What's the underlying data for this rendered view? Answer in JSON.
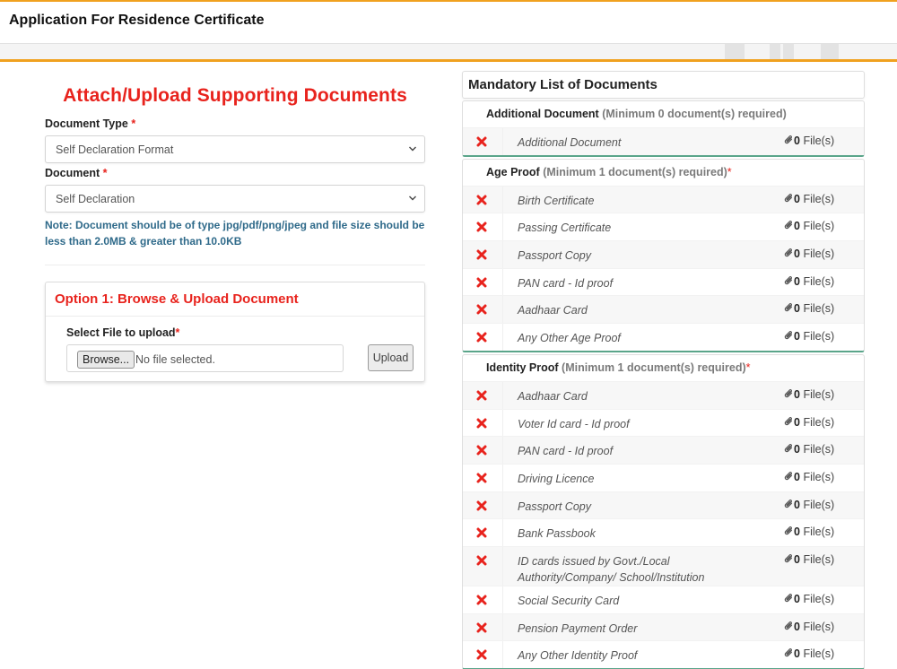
{
  "header": {
    "title": "Application For Residence Certificate"
  },
  "upload": {
    "heading": "Attach/Upload Supporting Documents",
    "document_type": {
      "label": "Document Type",
      "required_mark": "*",
      "value": "Self Declaration Format"
    },
    "document": {
      "label": "Document",
      "required_mark": "*",
      "value": "Self Declaration"
    },
    "note": "Note: Document should be of type jpg/pdf/png/jpeg and file size should be less than 2.0MB & greater than 10.0KB",
    "option1": {
      "title": "Option 1: Browse & Upload Document",
      "file_label": "Select File to upload",
      "required_mark": "*",
      "browse_label": "Browse...",
      "file_status": "No file selected.",
      "upload_label": "Upload"
    }
  },
  "mandatory": {
    "title": "Mandatory List of Documents",
    "groups": [
      {
        "name": "Additional Document",
        "requirement": "(Minimum 0 document(s) required)",
        "required_mark": "",
        "items": [
          {
            "name": "Additional Document",
            "count": "0",
            "unit": "File(s)"
          }
        ]
      },
      {
        "name": "Age Proof",
        "requirement": "(Minimum 1 document(s) required)",
        "required_mark": "*",
        "items": [
          {
            "name": "Birth Certificate",
            "count": "0",
            "unit": "File(s)"
          },
          {
            "name": "Passing Certificate",
            "count": "0",
            "unit": "File(s)"
          },
          {
            "name": "Passport Copy",
            "count": "0",
            "unit": "File(s)"
          },
          {
            "name": "PAN card - Id proof",
            "count": "0",
            "unit": "File(s)"
          },
          {
            "name": "Aadhaar Card",
            "count": "0",
            "unit": "File(s)"
          },
          {
            "name": "Any Other Age Proof",
            "count": "0",
            "unit": "File(s)"
          }
        ]
      },
      {
        "name": "Identity Proof",
        "requirement": "(Minimum 1 document(s) required)",
        "required_mark": "*",
        "items": [
          {
            "name": "Aadhaar Card",
            "count": "0",
            "unit": "File(s)"
          },
          {
            "name": "Voter Id card - Id proof",
            "count": "0",
            "unit": "File(s)"
          },
          {
            "name": "PAN card - Id proof",
            "count": "0",
            "unit": "File(s)"
          },
          {
            "name": "Driving Licence",
            "count": "0",
            "unit": "File(s)"
          },
          {
            "name": "Passport Copy",
            "count": "0",
            "unit": "File(s)"
          },
          {
            "name": "Bank Passbook",
            "count": "0",
            "unit": "File(s)"
          },
          {
            "name": "ID cards issued by Govt./Local Authority/Company/ School/Institution",
            "count": "0",
            "unit": "File(s)"
          },
          {
            "name": "Social Security Card",
            "count": "0",
            "unit": "File(s)"
          },
          {
            "name": "Pension Payment Order",
            "count": "0",
            "unit": "File(s)"
          },
          {
            "name": "Any Other Identity Proof",
            "count": "0",
            "unit": "File(s)"
          }
        ]
      }
    ]
  },
  "colors": {
    "accent": "#f0a11f",
    "heading_red": "#e8231d",
    "note_blue": "#2f6a8a",
    "group_border": "#5aa58a"
  }
}
